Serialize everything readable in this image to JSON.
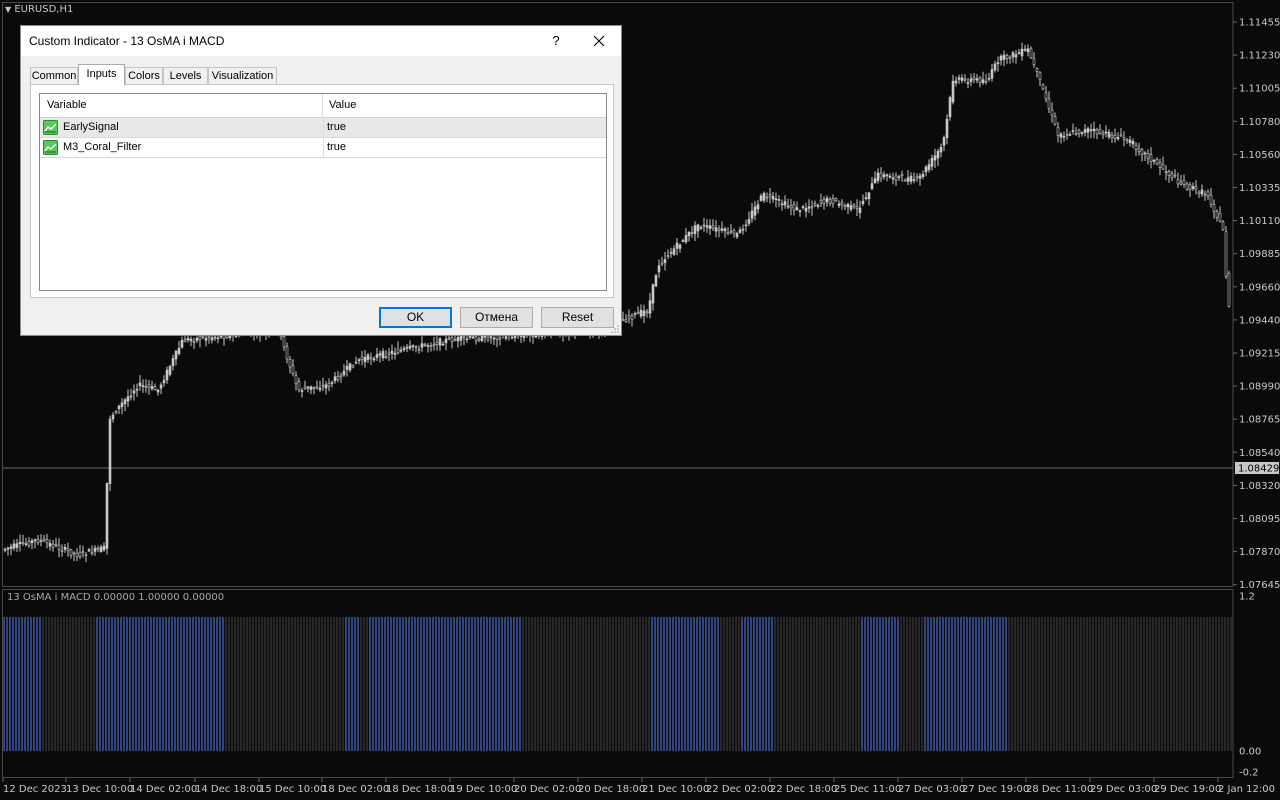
{
  "window": {
    "symbol_label": "EURUSD,H1"
  },
  "price_axis": {
    "ticks": [
      "1.11455",
      "1.11230",
      "1.11005",
      "1.10780",
      "1.10560",
      "1.10335",
      "1.10110",
      "1.09885",
      "1.09660",
      "1.09440",
      "1.09215",
      "1.08990",
      "1.08765",
      "1.08540",
      "1.08320",
      "1.08095",
      "1.07870",
      "1.07645"
    ],
    "current_price": "1.08429"
  },
  "time_axis": {
    "ticks": [
      "12 Dec 2023",
      "13 Dec 10:00",
      "14 Dec 02:00",
      "14 Dec 18:00",
      "15 Dec 10:00",
      "18 Dec 02:00",
      "18 Dec 18:00",
      "19 Dec 10:00",
      "20 Dec 02:00",
      "20 Dec 18:00",
      "21 Dec 10:00",
      "22 Dec 02:00",
      "22 Dec 18:00",
      "25 Dec 11:00",
      "27 Dec 03:00",
      "27 Dec 19:00",
      "28 Dec 11:00",
      "29 Dec 03:00",
      "29 Dec 19:00",
      "2 Jan 12:00"
    ]
  },
  "indicator": {
    "label": "13 OsMA i MACD 0.00000 1.00000 0.00000",
    "axis_ticks": [
      "1.2",
      "0.00",
      "-0.2"
    ]
  },
  "colors": {
    "background": "#0a0a0d",
    "candle": "#c8c8c8",
    "bar_blue": "#4b6ccc",
    "bar_gray": "#3c3c3c",
    "accent": "#0078d7"
  },
  "dialog": {
    "title": "Custom Indicator - 13 OsMA i MACD",
    "help_label": "?",
    "tabs": [
      {
        "label": "Common"
      },
      {
        "label": "Inputs",
        "active": true
      },
      {
        "label": "Colors"
      },
      {
        "label": "Levels"
      },
      {
        "label": "Visualization"
      }
    ],
    "table": {
      "headers": {
        "variable": "Variable",
        "value": "Value"
      },
      "rows": [
        {
          "variable": "EarlySignal",
          "value": "true",
          "icon": "indicator-param-icon"
        },
        {
          "variable": "M3_Coral_Filter",
          "value": "true",
          "icon": "indicator-param-icon"
        }
      ]
    },
    "buttons": {
      "ok": "OK",
      "cancel": "Отмена",
      "reset": "Reset"
    }
  }
}
